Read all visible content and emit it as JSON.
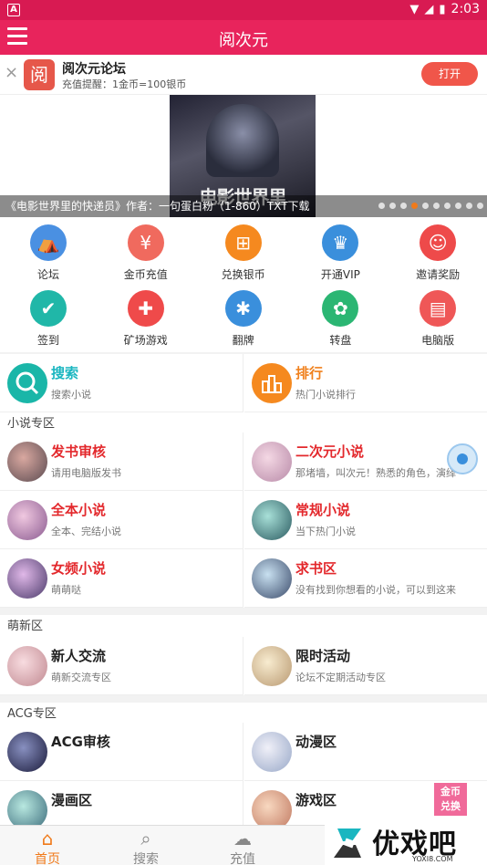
{
  "status_bar": {
    "time": "2:03"
  },
  "header": {
    "title": "阅次元"
  },
  "promo": {
    "logo_char": "阅",
    "name": "阅次元论坛",
    "desc": "充值提醒：1金币=100银币",
    "open_label": "打开"
  },
  "carousel": {
    "cover_title": "电影世界里",
    "caption": "《电影世界里的快递员》作者：一句蛋白粉（1-860）TXT下载",
    "dot_count": 10,
    "active_dot": 3
  },
  "icon_grid": [
    {
      "label": "论坛",
      "icon": "tent-icon",
      "color": "#4a90e2",
      "glyph": "⛺"
    },
    {
      "label": "金币充值",
      "icon": "yen-icon",
      "color": "#f06a5e",
      "glyph": "¥"
    },
    {
      "label": "兑换银币",
      "icon": "exchange-icon",
      "color": "#f5891f",
      "glyph": "⊞"
    },
    {
      "label": "开通VIP",
      "icon": "crown-icon",
      "color": "#3a8fdc",
      "glyph": "♛"
    },
    {
      "label": "邀请奖励",
      "icon": "smile-icon",
      "color": "#ee4a4a",
      "glyph": "☺"
    },
    {
      "label": "签到",
      "icon": "footprint-icon",
      "color": "#20b7a8",
      "glyph": "✔"
    },
    {
      "label": "矿场游戏",
      "icon": "gamepad-icon",
      "color": "#ef4a4a",
      "glyph": "✚"
    },
    {
      "label": "翻牌",
      "icon": "aperture-icon",
      "color": "#3a8fdc",
      "glyph": "✱"
    },
    {
      "label": "转盘",
      "icon": "wheel-icon",
      "color": "#2bb673",
      "glyph": "✿"
    },
    {
      "label": "电脑版",
      "icon": "document-icon",
      "color": "#ef5757",
      "glyph": "▤"
    }
  ],
  "quick": {
    "search": {
      "title": "搜索",
      "sub": "搜索小说"
    },
    "rank": {
      "title": "排行",
      "sub": "热门小说排行"
    }
  },
  "novel_zone": {
    "title": "小说专区",
    "items": [
      {
        "title": "发书审核",
        "sub": "请用电脑版发书"
      },
      {
        "title": "二次元小说",
        "sub": "那堵墙，叫次元！熟悉的角色，演绎"
      },
      {
        "title": "全本小说",
        "sub": "全本、完结小说"
      },
      {
        "title": "常规小说",
        "sub": "当下热门小说"
      },
      {
        "title": "女频小说",
        "sub": "萌萌哒"
      },
      {
        "title": "求书区",
        "sub": "没有找到你想看的小说，可以到这来"
      }
    ]
  },
  "new_zone": {
    "title": "萌新区",
    "items": [
      {
        "title": "新人交流",
        "sub": "萌新交流专区"
      },
      {
        "title": "限时活动",
        "sub": "论坛不定期活动专区"
      }
    ]
  },
  "acg_zone": {
    "title": "ACG专区",
    "items": [
      {
        "title": "ACG审核",
        "sub": ""
      },
      {
        "title": "动漫区",
        "sub": ""
      },
      {
        "title": "漫画区",
        "sub": ""
      },
      {
        "title": "游戏区",
        "sub": ""
      }
    ]
  },
  "coin_exchange": {
    "line1": "金币",
    "line2": "兑换"
  },
  "bottom_nav": [
    {
      "label": "首页",
      "icon": "home-icon"
    },
    {
      "label": "搜索",
      "icon": "search-icon"
    },
    {
      "label": "充值",
      "icon": "chat-icon"
    }
  ],
  "watermark": {
    "text": "优戏吧",
    "url": "YOXI8.COM"
  },
  "colors": {
    "primary": "#e8245c",
    "accent": "#f07a1a",
    "red_title": "#e3282c",
    "teal": "#1ab6c0"
  }
}
